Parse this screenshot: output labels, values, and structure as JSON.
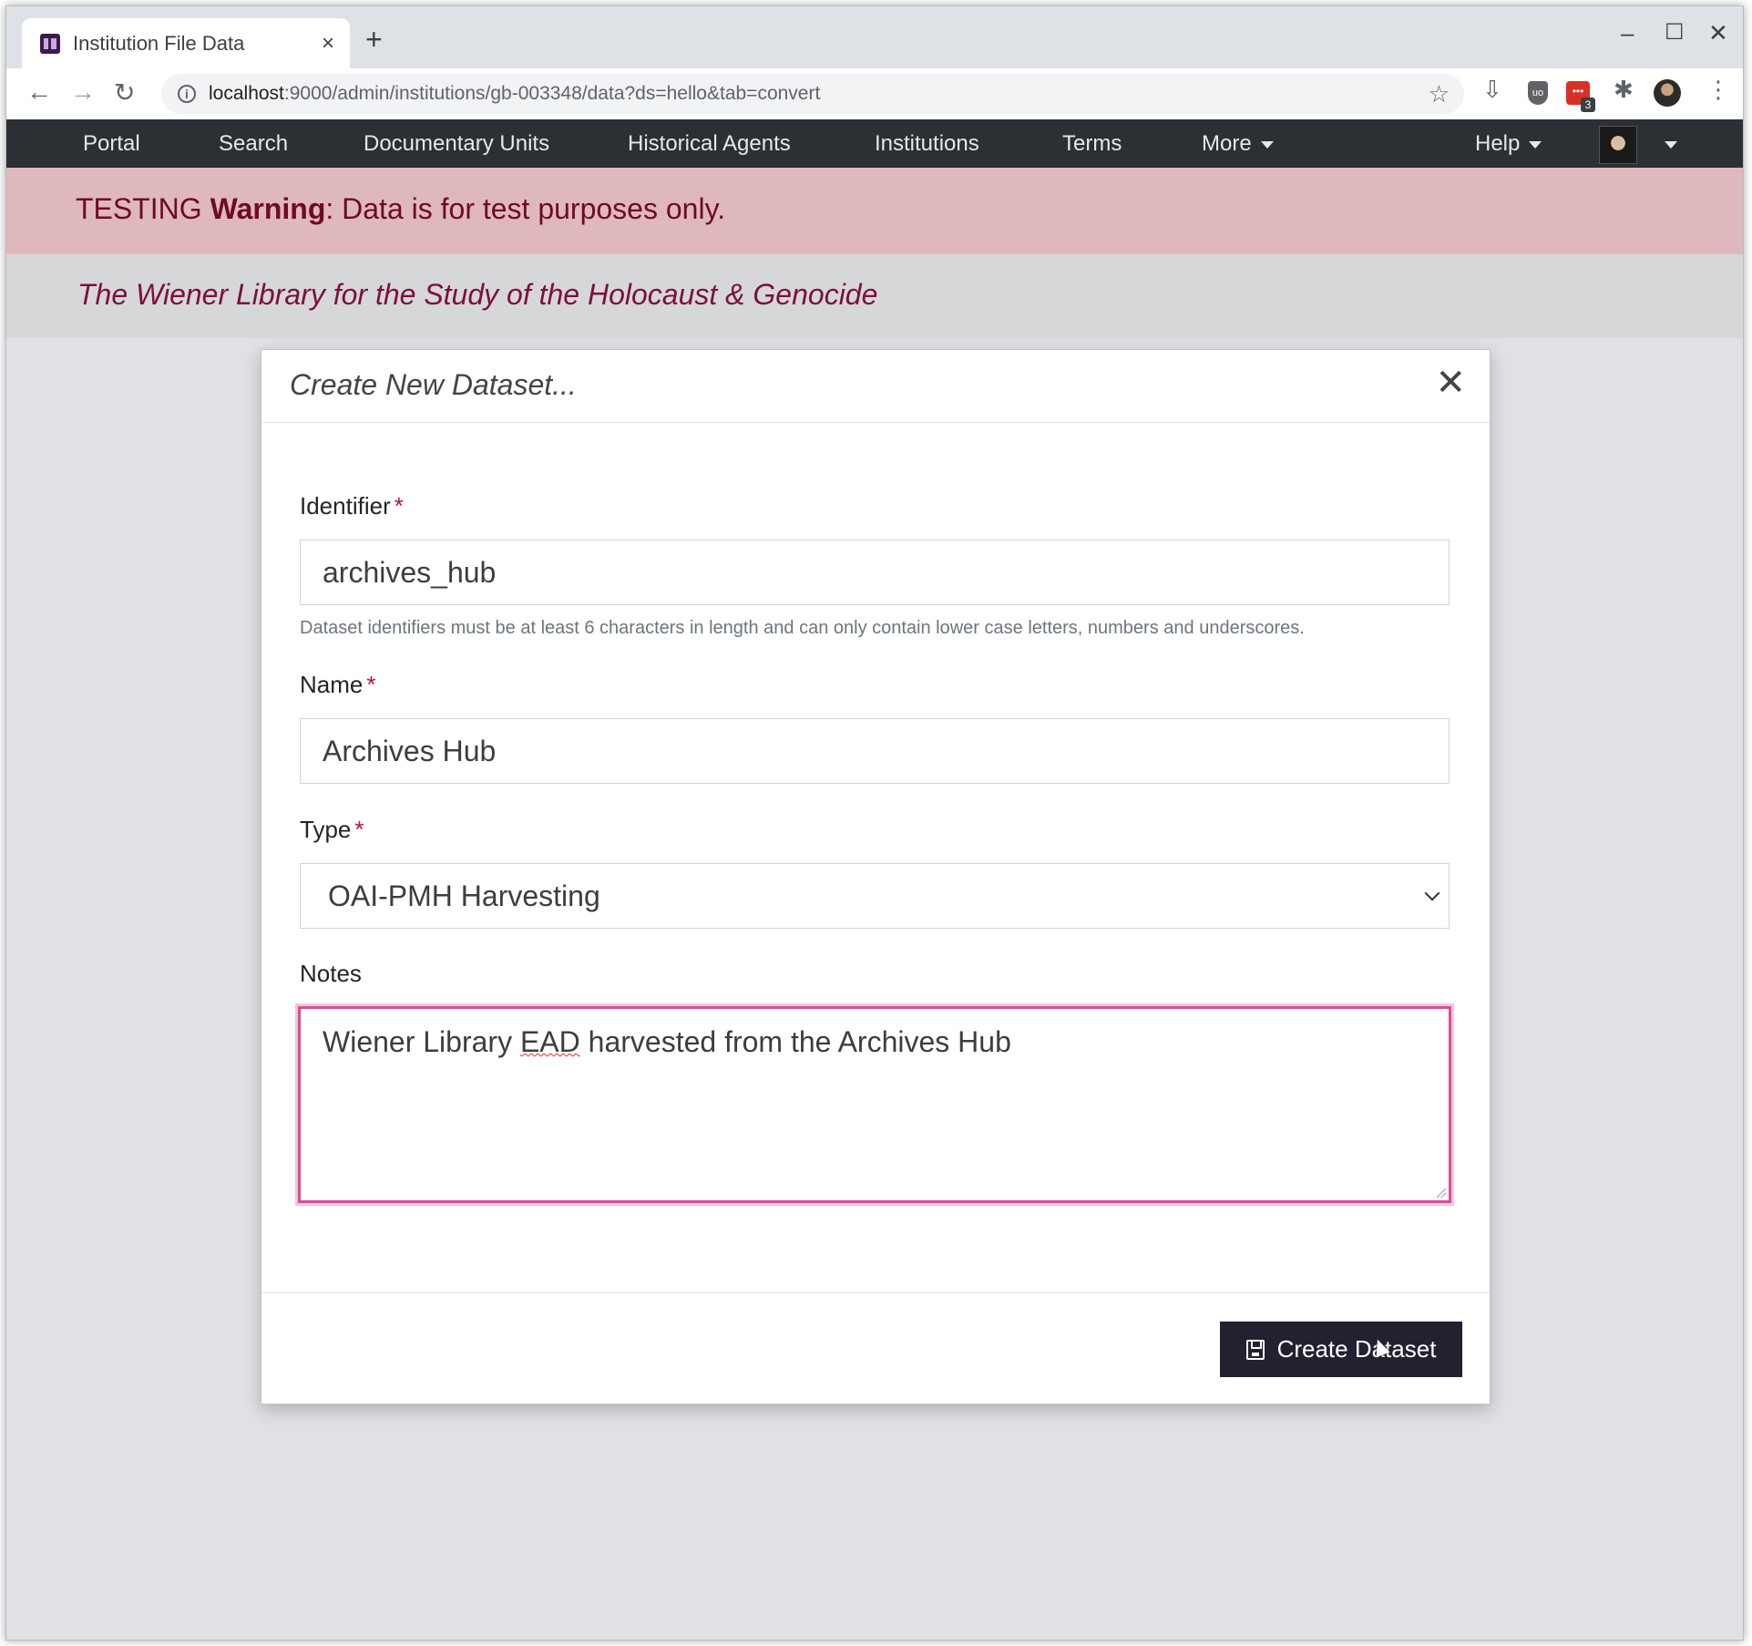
{
  "browser": {
    "tab_title": "Institution File Data",
    "tab_close": "×",
    "new_tab": "+",
    "window_controls": {
      "minimize": "–",
      "maximize": "☐",
      "close": "✕"
    },
    "nav": {
      "back": "←",
      "forward": "→",
      "reload": "↻"
    },
    "url_host": "localhost",
    "url_rest": ":9000/admin/institutions/gb-003348/data?ds=hello&tab=convert",
    "star": "☆",
    "extensions": {
      "ublock_text": "uo",
      "red_ext_text": "•••",
      "red_ext_badge": "3",
      "download_icon": "⇩",
      "puzzle_icon": "✱",
      "menu_icon": "⋮"
    }
  },
  "navbar": {
    "items": [
      {
        "label": "Portal"
      },
      {
        "label": "Search"
      },
      {
        "label": "Documentary Units"
      },
      {
        "label": "Historical Agents"
      },
      {
        "label": "Institutions"
      },
      {
        "label": "Terms"
      },
      {
        "label": "More"
      }
    ],
    "help": "Help"
  },
  "alert": {
    "prefix": "TESTING ",
    "strong": "Warning",
    "message": ": Data is for test purposes only."
  },
  "banner": {
    "title": "The Wiener Library for the Study of the Holocaust & Genocide"
  },
  "modal": {
    "title": "Create New Dataset...",
    "close": "✕",
    "required_marker": "*",
    "identifier": {
      "label": "Identifier",
      "value": "archives_hub",
      "help": "Dataset identifiers must be at least 6 characters in length and can only contain lower case letters, numbers and underscores."
    },
    "name": {
      "label": "Name",
      "value": "Archives Hub"
    },
    "type": {
      "label": "Type",
      "selected": "OAI-PMH Harvesting"
    },
    "notes": {
      "label": "Notes",
      "value_before": "Wiener Library ",
      "value_misspelled": "EAD",
      "value_after": " harvested from the Archives Hub"
    },
    "submit_label": "Create Dataset"
  },
  "colors": {
    "navbar_bg": "#2c3034",
    "alert_bg": "#dfb8be",
    "alert_text": "#6e0b22",
    "banner_title": "#7d0f3f",
    "required": "#b8123c",
    "focus_border": "#d24f98",
    "button_bg": "#25202f"
  }
}
